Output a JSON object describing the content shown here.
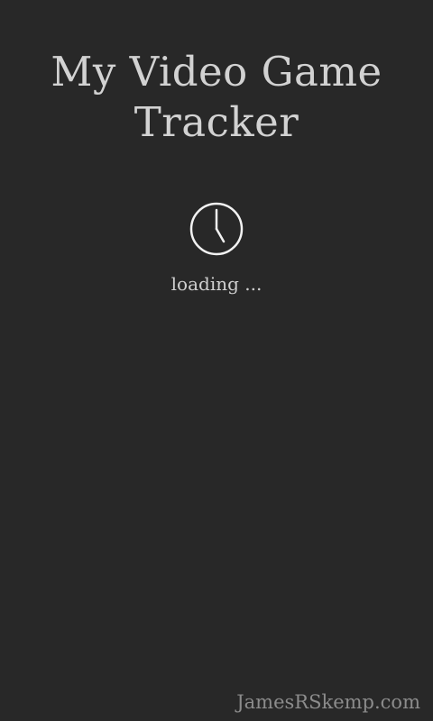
{
  "app": {
    "title": "My Video Game Tracker",
    "background_color": "#282828",
    "text_color": "#d4d4d4"
  },
  "loading": {
    "icon": "clock-icon",
    "text": "loading ..."
  },
  "footer": {
    "link_text": "JamesRSkemp.com",
    "link_color": "#8c8c8c"
  }
}
